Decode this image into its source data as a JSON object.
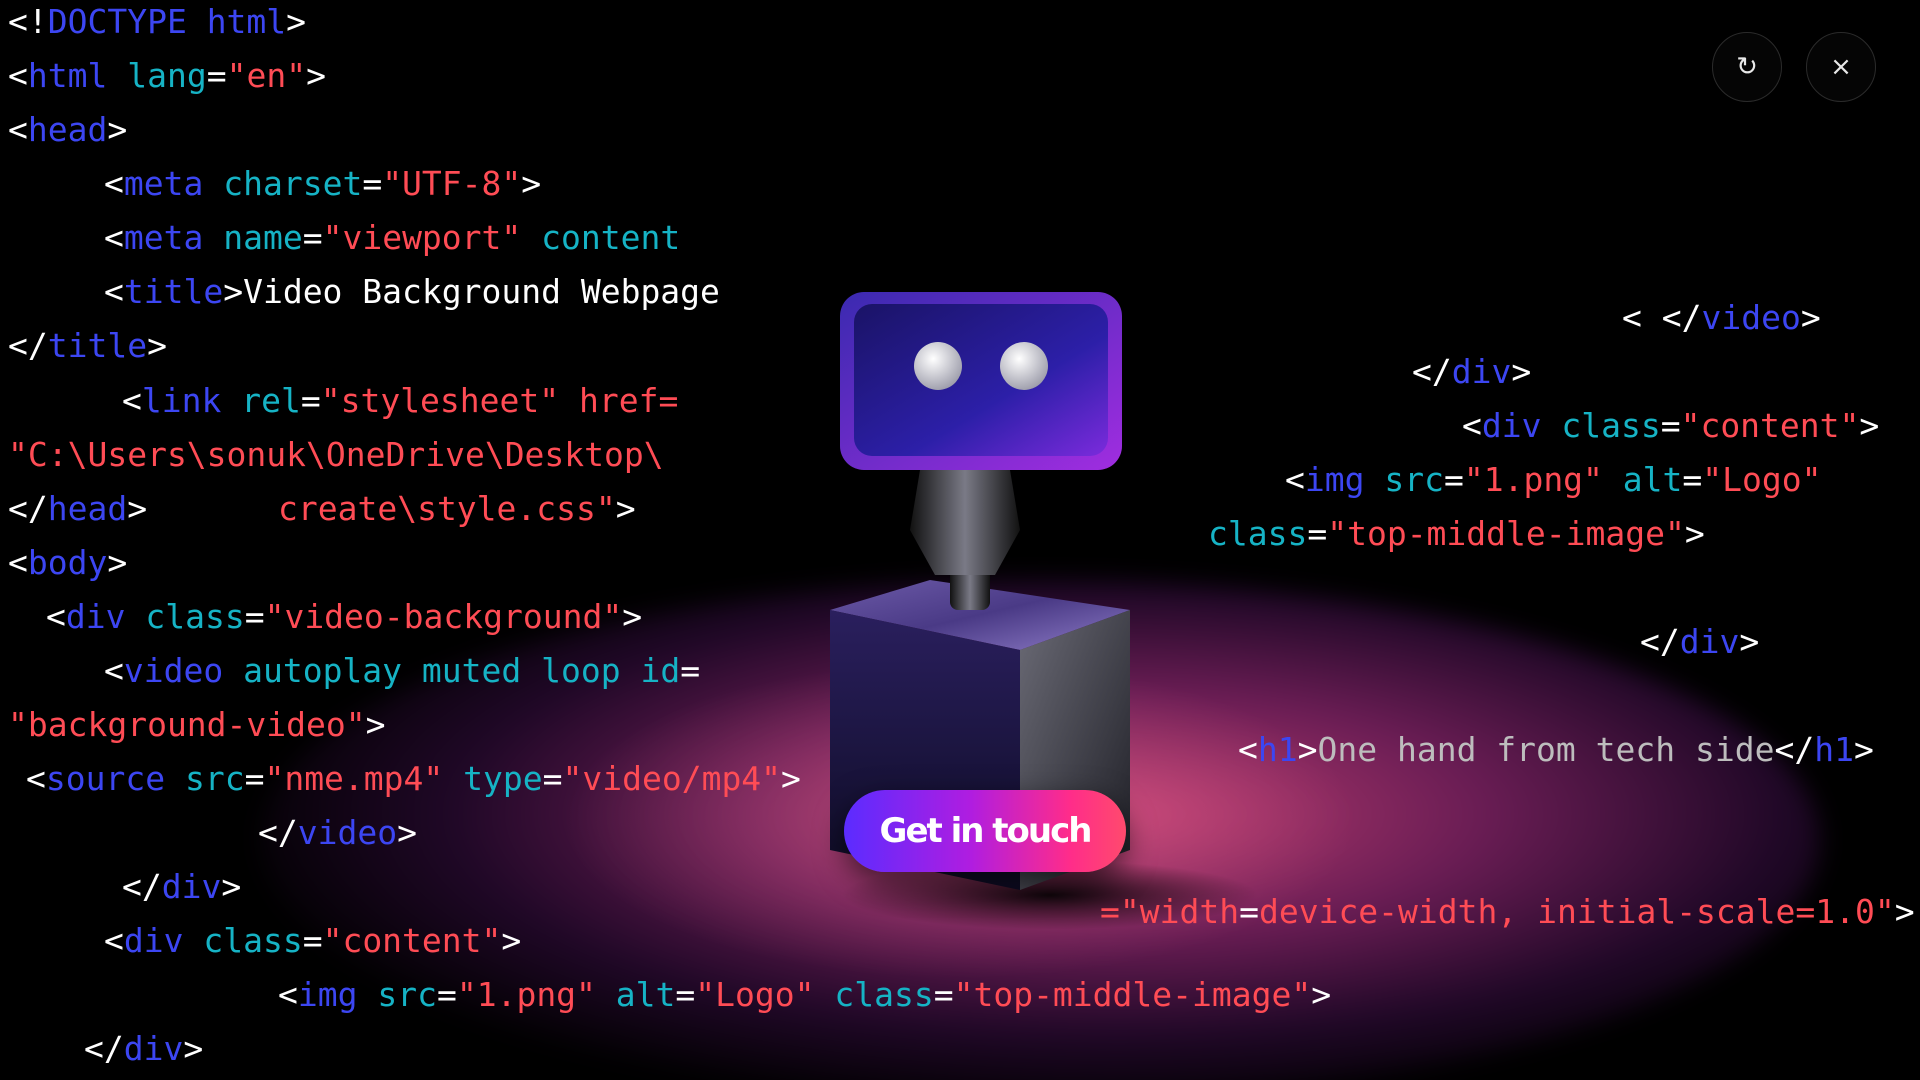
{
  "toolbar": {
    "reload_icon": "↻",
    "close_icon": "×"
  },
  "hero": {
    "cta_label": "Get in touch"
  },
  "code_lines": [
    {
      "tokens": [
        {
          "t": "<!"
        },
        {
          "t": "DOCTYPE html",
          "k": "t"
        },
        {
          "t": ">"
        }
      ]
    },
    {
      "tokens": [
        {
          "t": "<"
        },
        {
          "t": "html",
          "k": "t"
        },
        {
          "t": " "
        },
        {
          "t": "lang",
          "k": "a"
        },
        {
          "t": "="
        },
        {
          "t": "\"en\"",
          "k": "s"
        },
        {
          "t": ">"
        }
      ]
    },
    {
      "tokens": [
        {
          "t": "<"
        },
        {
          "t": "head",
          "k": "t"
        },
        {
          "t": ">"
        }
      ]
    },
    {
      "tokens": [
        {
          "t": "<"
        },
        {
          "t": "meta",
          "k": "t"
        },
        {
          "t": " "
        },
        {
          "t": "charset",
          "k": "a"
        },
        {
          "t": "="
        },
        {
          "t": "\"UTF-8\"",
          "k": "s"
        },
        {
          "t": ">"
        }
      ]
    },
    {
      "tokens": [
        {
          "t": "<"
        },
        {
          "t": "meta",
          "k": "t"
        },
        {
          "t": " "
        },
        {
          "t": "name",
          "k": "a"
        },
        {
          "t": "="
        },
        {
          "t": "\"viewport\"",
          "k": "s"
        },
        {
          "t": " "
        },
        {
          "t": "content",
          "k": "a"
        }
      ]
    },
    {
      "tokens": [
        {
          "t": "<"
        },
        {
          "t": "title",
          "k": "t"
        },
        {
          "t": ">Video Background Webpage"
        }
      ]
    },
    {
      "tokens": [
        {
          "t": "</"
        },
        {
          "t": "title",
          "k": "t"
        },
        {
          "t": ">"
        }
      ]
    },
    {
      "tokens": [
        {
          "t": "<"
        },
        {
          "t": "link",
          "k": "t"
        },
        {
          "t": " "
        },
        {
          "t": "rel",
          "k": "a"
        },
        {
          "t": "="
        },
        {
          "t": "\"stylesheet\"",
          "k": "s"
        },
        {
          "t": " "
        },
        {
          "t": "href=",
          "k": "s"
        }
      ]
    },
    {
      "tokens": [
        {
          "t": "\"C:\\Users\\sonuk\\OneDrive\\Desktop\\",
          "k": "s"
        }
      ]
    },
    {
      "tokens": [
        {
          "t": "</"
        },
        {
          "t": "head",
          "k": "t"
        },
        {
          "t": ">"
        }
      ]
    },
    {
      "tokens": [
        {
          "t": "create\\style.css\"",
          "k": "s"
        },
        {
          "t": ">"
        }
      ]
    },
    {
      "tokens": [
        {
          "t": "<"
        },
        {
          "t": "body",
          "k": "t"
        },
        {
          "t": ">"
        }
      ]
    },
    {
      "tokens": [
        {
          "t": "<"
        },
        {
          "t": "div",
          "k": "t"
        },
        {
          "t": " "
        },
        {
          "t": "class",
          "k": "a"
        },
        {
          "t": "="
        },
        {
          "t": "\"video-background\"",
          "k": "s"
        },
        {
          "t": ">"
        }
      ]
    },
    {
      "tokens": [
        {
          "t": "<"
        },
        {
          "t": "video",
          "k": "t"
        },
        {
          "t": " "
        },
        {
          "t": "autoplay muted loop id",
          "k": "a"
        },
        {
          "t": "="
        }
      ]
    },
    {
      "tokens": [
        {
          "t": "\"background-video\"",
          "k": "s"
        },
        {
          "t": ">"
        }
      ]
    },
    {
      "tokens": [
        {
          "t": "<"
        },
        {
          "t": "source",
          "k": "t"
        },
        {
          "t": " "
        },
        {
          "t": "src",
          "k": "a"
        },
        {
          "t": "="
        },
        {
          "t": "\"nme.mp4\"",
          "k": "s"
        },
        {
          "t": " "
        },
        {
          "t": "type",
          "k": "a"
        },
        {
          "t": "="
        },
        {
          "t": "\"video/mp4\"",
          "k": "s"
        },
        {
          "t": ">"
        }
      ]
    },
    {
      "tokens": [
        {
          "t": "</"
        },
        {
          "t": "video",
          "k": "t"
        },
        {
          "t": ">"
        }
      ]
    },
    {
      "tokens": [
        {
          "t": "</"
        },
        {
          "t": "div",
          "k": "t"
        },
        {
          "t": ">"
        }
      ]
    },
    {
      "tokens": [
        {
          "t": "<"
        },
        {
          "t": "div",
          "k": "t"
        },
        {
          "t": " "
        },
        {
          "t": "class",
          "k": "a"
        },
        {
          "t": "="
        },
        {
          "t": "\"content\"",
          "k": "s"
        },
        {
          "t": ">"
        }
      ]
    },
    {
      "tokens": [
        {
          "t": "<"
        },
        {
          "t": "img",
          "k": "t"
        },
        {
          "t": " "
        },
        {
          "t": "src",
          "k": "a"
        },
        {
          "t": "="
        },
        {
          "t": "\"1.png\"",
          "k": "s"
        },
        {
          "t": " "
        },
        {
          "t": "alt",
          "k": "a"
        },
        {
          "t": "="
        },
        {
          "t": "\"Logo\"",
          "k": "s"
        },
        {
          "t": " "
        },
        {
          "t": "class",
          "k": "a"
        },
        {
          "t": "="
        },
        {
          "t": "\"top-middle-image\"",
          "k": "s"
        },
        {
          "t": ">"
        }
      ]
    },
    {
      "tokens": [
        {
          "t": "</"
        },
        {
          "t": "div",
          "k": "t"
        },
        {
          "t": ">"
        }
      ]
    },
    {
      "tokens": [
        {
          "t": "< </"
        },
        {
          "t": "video",
          "k": "t"
        },
        {
          "t": ">"
        }
      ]
    },
    {
      "tokens": [
        {
          "t": "</"
        },
        {
          "t": "div",
          "k": "t"
        },
        {
          "t": ">"
        }
      ]
    },
    {
      "tokens": [
        {
          "t": "<"
        },
        {
          "t": "div",
          "k": "t"
        },
        {
          "t": " "
        },
        {
          "t": "class",
          "k": "a"
        },
        {
          "t": "="
        },
        {
          "t": "\"content\"",
          "k": "s"
        },
        {
          "t": ">"
        }
      ]
    },
    {
      "tokens": [
        {
          "t": "<"
        },
        {
          "t": "img",
          "k": "t"
        },
        {
          "t": " "
        },
        {
          "t": "src",
          "k": "a"
        },
        {
          "t": "="
        },
        {
          "t": "\"1.png\"",
          "k": "s"
        },
        {
          "t": " "
        },
        {
          "t": "alt",
          "k": "a"
        },
        {
          "t": "="
        },
        {
          "t": "\"Logo\"",
          "k": "s"
        }
      ]
    },
    {
      "tokens": [
        {
          "t": "class",
          "k": "a"
        },
        {
          "t": "="
        },
        {
          "t": "\"top-middle-image\"",
          "k": "s"
        },
        {
          "t": ">"
        }
      ]
    },
    {
      "tokens": [
        {
          "t": "</"
        },
        {
          "t": "div",
          "k": "t"
        },
        {
          "t": ">"
        }
      ]
    },
    {
      "tokens": [
        {
          "t": "<"
        },
        {
          "t": "h1",
          "k": "t"
        },
        {
          "t": ">"
        },
        {
          "t": "One hand from tech side",
          "k": "g"
        },
        {
          "t": "</"
        },
        {
          "t": "h1",
          "k": "t"
        },
        {
          "t": ">"
        }
      ]
    },
    {
      "tokens": [
        {
          "t": "=\"",
          "k": "s"
        },
        {
          "t": "width",
          "k": "s"
        },
        {
          "t": "="
        },
        {
          "t": "device-width, initial-scale=1.0\"",
          "k": "s"
        },
        {
          "t": ">"
        }
      ]
    }
  ]
}
